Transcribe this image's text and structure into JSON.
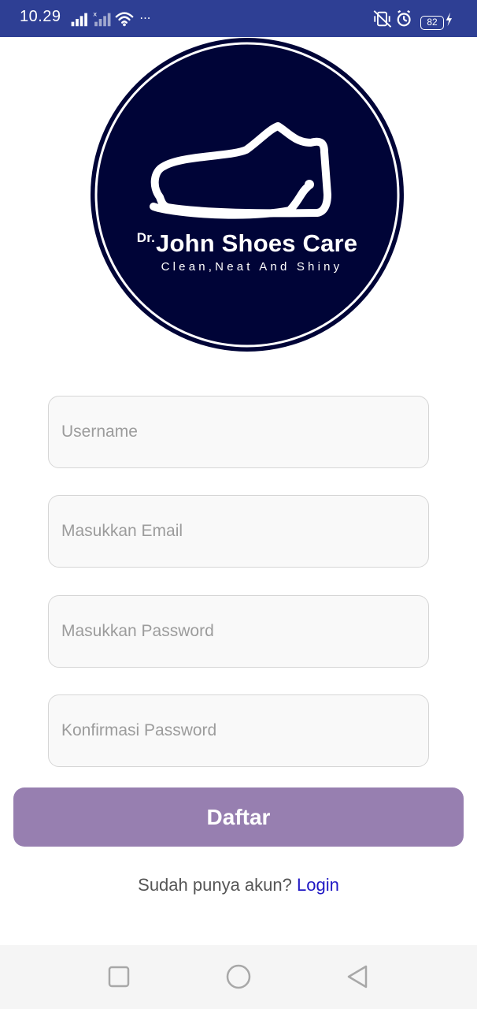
{
  "status_bar": {
    "time": "10.29",
    "more": "···",
    "battery": "82"
  },
  "logo": {
    "prefix": "Dr.",
    "title": "John Shoes Care",
    "tagline": "Clean,Neat And Shiny",
    "colors": {
      "background": "#000437",
      "foreground": "#ffffff"
    }
  },
  "form": {
    "username_placeholder": "Username",
    "email_placeholder": "Masukkan Email",
    "password_placeholder": "Masukkan Password",
    "confirm_placeholder": "Konfirmasi Password",
    "submit_label": "Daftar"
  },
  "login_prompt": {
    "text": "Sudah punya akun?",
    "link_label": "Login"
  },
  "nav_bar": {
    "icons": [
      "recent-apps-icon",
      "home-icon",
      "back-icon"
    ]
  },
  "theme": {
    "status_bar": "#2e3f94",
    "button": "#977fb0",
    "link": "#2018c4"
  }
}
